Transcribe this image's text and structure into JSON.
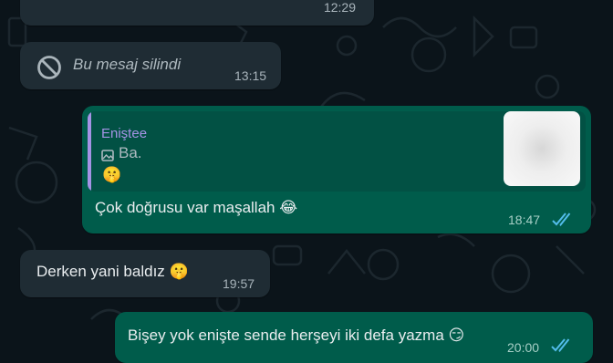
{
  "chat": {
    "messages": [
      {
        "id": "top-partial",
        "direction": "incoming",
        "time": "12:29"
      },
      {
        "id": "deleted",
        "direction": "incoming",
        "text": "Bu mesaj silindi",
        "time": "13:15",
        "icon": "blocked-icon"
      },
      {
        "id": "reply",
        "direction": "outgoing",
        "quote": {
          "author": "Enişteе",
          "text": "Ba.",
          "emoji": "🤫"
        },
        "text": "Çok doğrusu var maşallah 😂",
        "time": "18:47",
        "status": "read"
      },
      {
        "id": "baldiz",
        "direction": "incoming",
        "text": "Derken yani baldız 🤫",
        "time": "19:57"
      },
      {
        "id": "bottom",
        "direction": "outgoing",
        "text": "Bişey yok enişte sende herşeyi iki defa yazma 😏",
        "time": "20:00",
        "status": "read"
      }
    ]
  },
  "colors": {
    "background": "#0b141a",
    "incoming_bubble": "#1f2c34",
    "outgoing_bubble": "#005c4b",
    "quote_author": "#a593e5",
    "read_ticks": "#53bdeb"
  }
}
